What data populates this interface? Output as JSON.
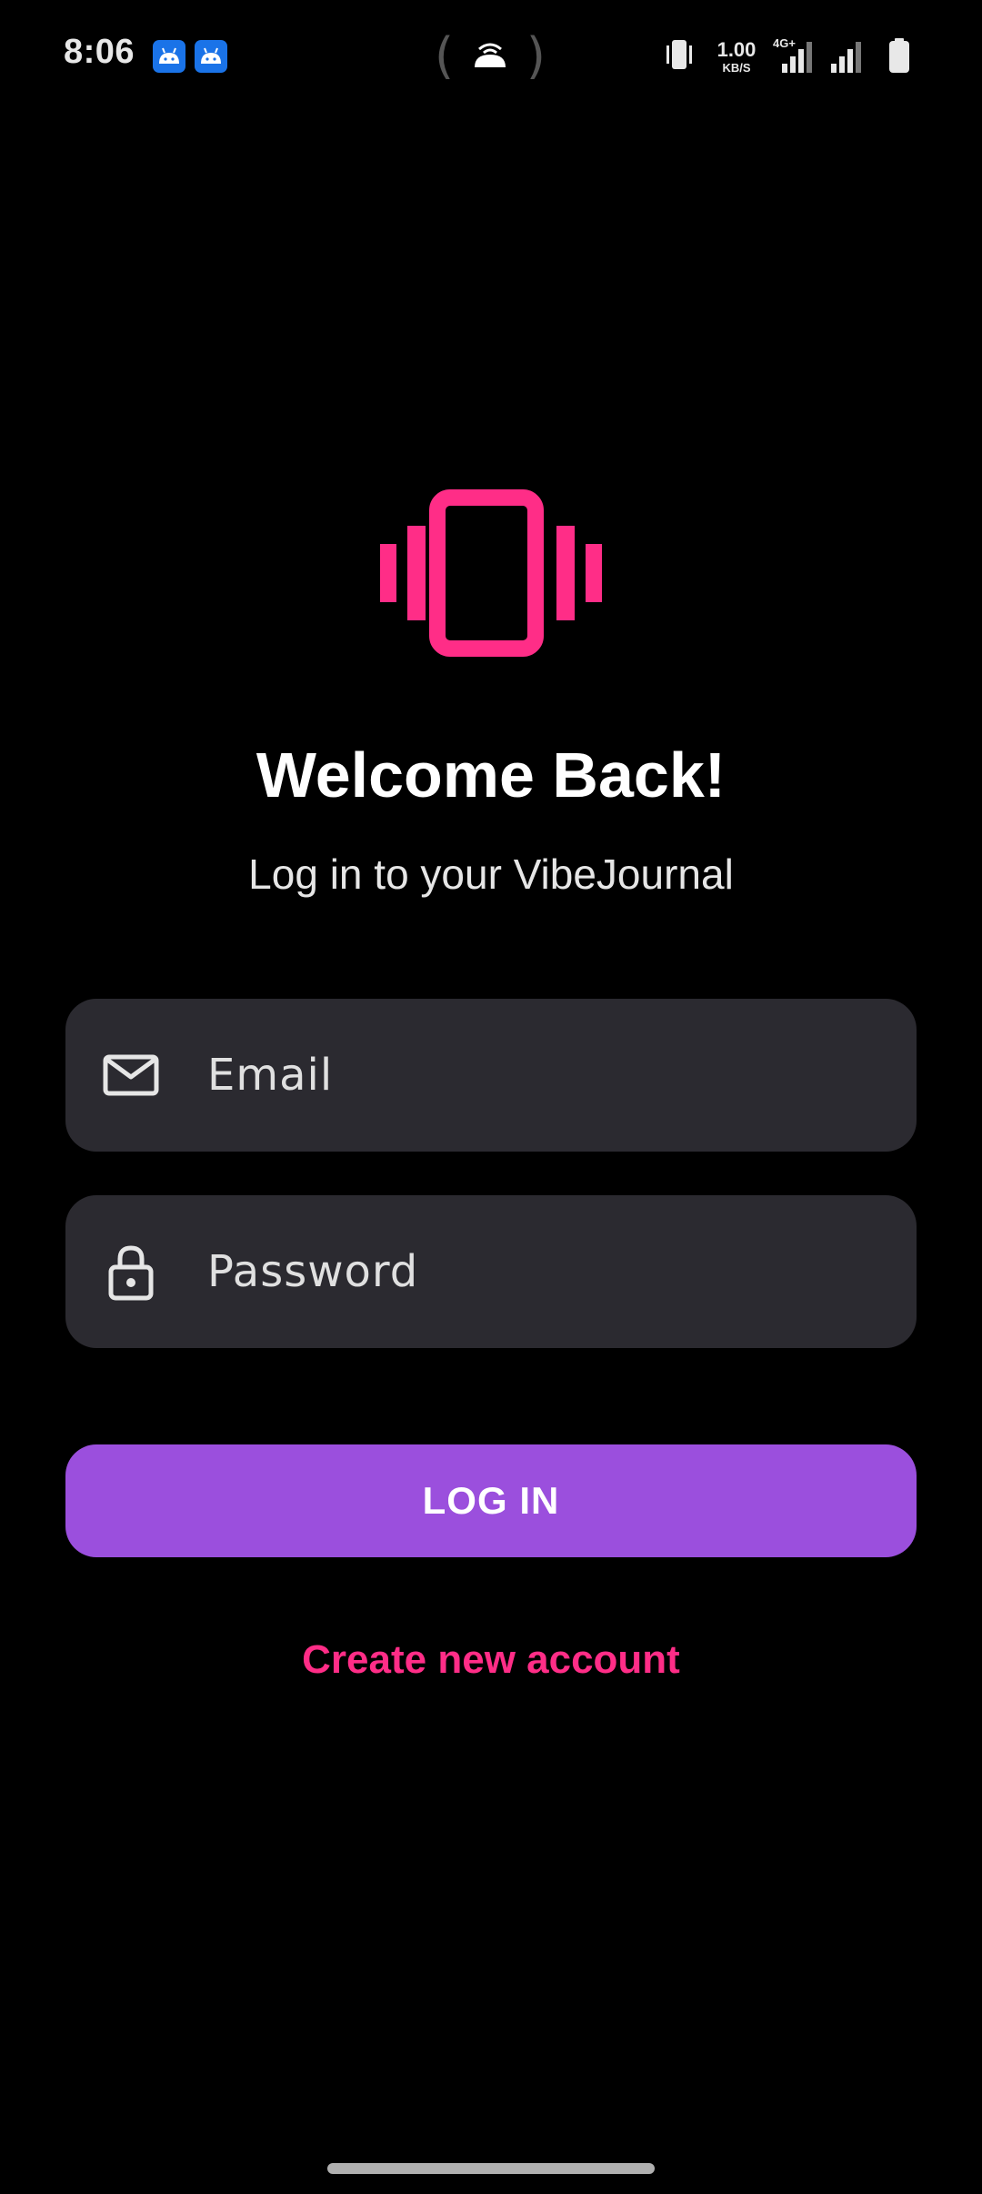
{
  "status_bar": {
    "time": "8:06",
    "network_speed_value": "1.00",
    "network_speed_unit": "KB/S",
    "network_type": "4G+",
    "notification_icons": [
      "android-icon",
      "android-icon"
    ],
    "right_icons": [
      "vibrate-icon",
      "network-speed",
      "signal-4g-icon",
      "signal-icon",
      "battery-icon"
    ]
  },
  "logo": {
    "icon": "phone-vibrate-icon",
    "color": "#ff2d87"
  },
  "welcome": {
    "title": "Welcome Back!",
    "subtitle": "Log in to your VibeJournal"
  },
  "form": {
    "email": {
      "icon": "mail-icon",
      "placeholder": "Email",
      "value": ""
    },
    "password": {
      "icon": "lock-icon",
      "placeholder": "Password",
      "value": ""
    },
    "login_label": "LOG IN",
    "create_account_label": "Create new account"
  },
  "colors": {
    "background": "#000000",
    "accent_pink": "#ff2d87",
    "button_purple": "#9b4fdd",
    "field_bg": "#2b2a30"
  }
}
